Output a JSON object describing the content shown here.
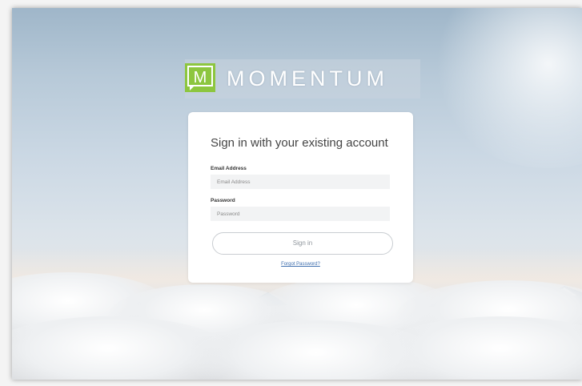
{
  "brand": {
    "name": "MOMENTUM",
    "logo_letter": "M",
    "logo_color": "#8dc63f",
    "logo_icon": "momentum-speech-bubble-logo"
  },
  "login": {
    "title": "Sign in with your existing account",
    "email_label": "Email Address",
    "email_placeholder": "Email Address",
    "email_value": "",
    "password_label": "Password",
    "password_placeholder": "Password",
    "password_value": "",
    "signin_button": "Sign in",
    "forgot_link": "Forgot Password?"
  },
  "colors": {
    "link": "#3f6fae",
    "button_text": "#8f969c",
    "input_bg": "#f2f3f4"
  }
}
